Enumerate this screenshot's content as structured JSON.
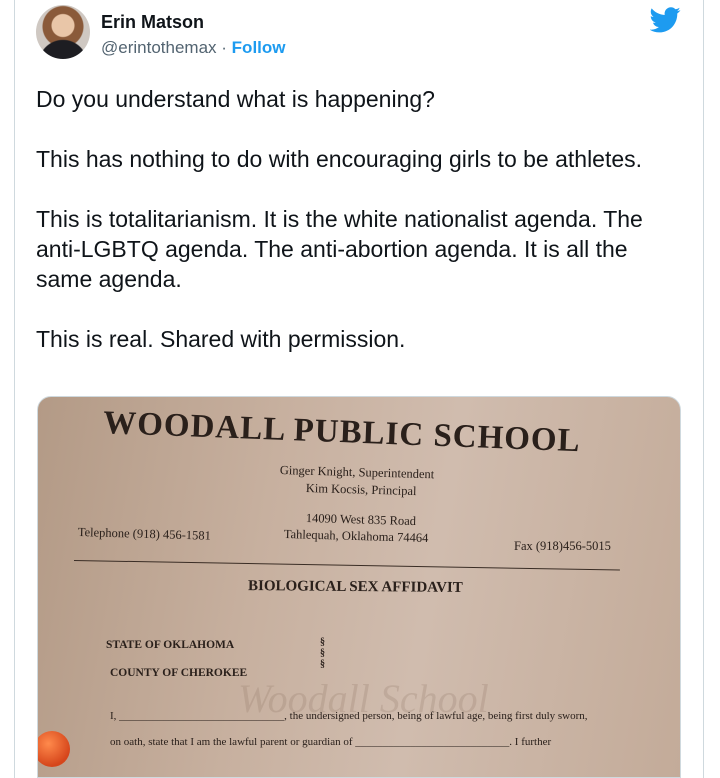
{
  "author": {
    "name": "Erin Matson",
    "handle": "@erintothemax",
    "separator": "·",
    "follow_label": "Follow"
  },
  "tweet": {
    "paragraphs": [
      "Do you understand what is happening?",
      "This has nothing to do with encouraging girls to be athletes.",
      "This is totalitarianism. It is the white nationalist agenda. The anti-LGBTQ agenda. The anti-abortion agenda. It is all the same agenda.",
      "This is real. Shared with permission."
    ]
  },
  "document": {
    "school": "WOODALL PUBLIC SCHOOL",
    "superintendent": "Ginger Knight, Superintendent",
    "principal": "Kim Kocsis, Principal",
    "address_line1": "14090 West 835 Road",
    "address_line2": "Tahlequah, Oklahoma 74464",
    "telephone": "Telephone (918) 456-1581",
    "fax": "Fax (918)456-5015",
    "title": "BIOLOGICAL SEX AFFIDAVIT",
    "state": "STATE OF OKLAHOMA",
    "county": "COUNTY OF CHEROKEE",
    "section_marks": "§\n§\n§",
    "body_line1": "I, ______________________________, the undersigned person, being of lawful age, being first duly sworn,",
    "body_line2": "on oath, state that I am the lawful parent or guardian of ____________________________. I further",
    "watermark": "Woodall School"
  },
  "colors": {
    "text": "#0f1419",
    "muted": "#536471",
    "accent": "#1d9bf0"
  },
  "icons": {
    "logo": "twitter-bird-icon"
  }
}
